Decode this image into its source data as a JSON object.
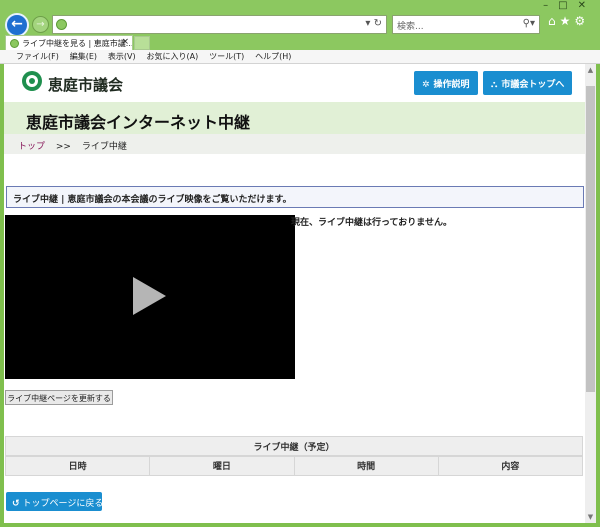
{
  "browser": {
    "search_placeholder": "検索...",
    "tab_title": "ライブ中継を見る | 恵庭市議...",
    "menu": [
      "ファイル(F)",
      "編集(E)",
      "表示(V)",
      "お気に入り(A)",
      "ツール(T)",
      "ヘルプ(H)"
    ]
  },
  "header": {
    "site_name": "恵庭市議会",
    "guide_button": "操作説明",
    "top_button": "市議会トップへ"
  },
  "page": {
    "title": "恵庭市議会インターネット中継",
    "breadcrumb": {
      "home": "トップ",
      "separator": ">>",
      "current": "ライブ中継"
    },
    "intro": "ライブ中継 | 恵庭市議会の本会議のライブ映像をご覧いただけます。",
    "status": "現在、ライブ中継は行っておりません。",
    "refresh_button": "ライブ中継ページを更新する",
    "schedule": {
      "caption": "ライブ中継（予定）",
      "columns": [
        "日時",
        "曜日",
        "時間",
        "内容"
      ]
    },
    "back_button": "トップページに戻る"
  },
  "colors": {
    "chrome": "#8cc860",
    "accent": "#1a8ed0",
    "title_band": "#e1f0d6"
  }
}
